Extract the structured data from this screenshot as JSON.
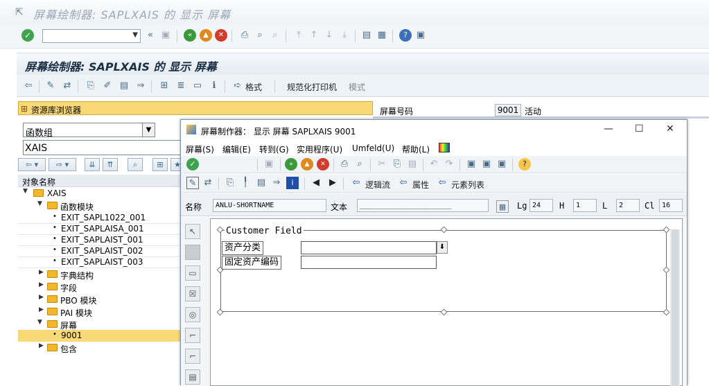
{
  "window": {
    "title": "屏幕绘制器: SAPLXAIS 的 显示 屏幕"
  },
  "header": {
    "title": "屏幕绘制器: SAPLXAIS 的 显示 屏幕"
  },
  "app_toolbar": {
    "format_label": "格式",
    "print_label": "规范化打印机",
    "mode_label": "模式"
  },
  "left_panel": {
    "repo_label": "资源库浏览器",
    "object_type": "函数组",
    "object_name": "XAIS",
    "tree_header": "对象名称",
    "tree": {
      "root": "XAIS",
      "function_modules": "函数模块",
      "fm1": "EXIT_SAPL1022_001",
      "fm2": "EXIT_SAPLAISA_001",
      "fm3": "EXIT_SAPLAIST_001",
      "fm4": "EXIT_SAPLAIST_002",
      "fm5": "EXIT_SAPLAIST_003",
      "dict": "字典结构",
      "fields": "字段",
      "pbo": "PBO 模块",
      "pai": "PAI 模块",
      "screens": "屏幕",
      "screen1": "9001",
      "includes": "包含"
    }
  },
  "screen_info": {
    "label": "屏幕号码",
    "number": "9001",
    "status": "活动"
  },
  "dialog": {
    "title": "屏幕制作器： 显示 屏幕 SAPLXAIS 9001",
    "menu": [
      "屏幕(S)",
      "编辑(E)",
      "转到(G)",
      "实用程序(U)",
      "Umfeld(U)",
      "帮助(L)"
    ],
    "toolbar2": {
      "logic_flow": "逻辑流",
      "attributes": "属性",
      "element_list": "元素列表"
    },
    "fields": {
      "name_label": "名称",
      "name_value": "ANLU-SHORTNAME",
      "text_label": "文本",
      "text_value": "______________________",
      "lg_label": "Lg",
      "lg_value": "24",
      "h_label": "H",
      "h_value": "1",
      "l_label": "L",
      "l_value": "2",
      "cl_label": "Cl",
      "cl_value": "16"
    },
    "canvas": {
      "frame_title": "Customer  Field",
      "label1": "资产分类",
      "label2": "固定资产编码"
    }
  },
  "colors": {
    "highlight": "#f9d976",
    "header_text": "#1a2e44"
  }
}
